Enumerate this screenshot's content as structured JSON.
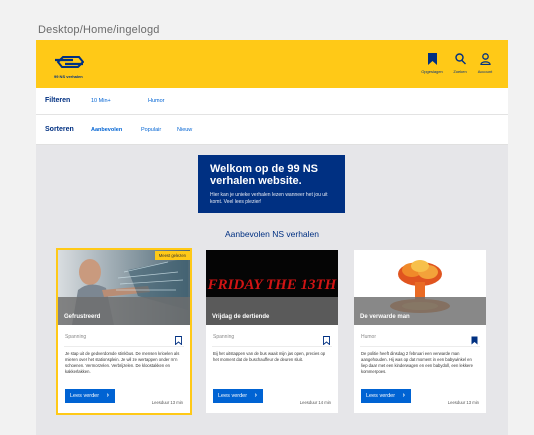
{
  "frame_label": "Desktop/Home/ingelogd",
  "header": {
    "logo_text": "99 NS verhalen",
    "nav": [
      {
        "label": "Opgeslagen",
        "icon": "bookmark-icon"
      },
      {
        "label": "Zoeken",
        "icon": "search-icon"
      },
      {
        "label": "Account",
        "icon": "user-icon"
      }
    ]
  },
  "filters": {
    "title": "Filteren",
    "options": [
      "10 Min+",
      "Humor"
    ]
  },
  "sort": {
    "title": "Sorteren",
    "options": [
      "Aanbevolen",
      "Populair",
      "Nieuw"
    ],
    "active": "Aanbevolen"
  },
  "hero": {
    "title": "Welkom op de 99 NS verhalen website.",
    "text": "Hier kan je unieke verhalen lezen wanneer het jou uit komt. Veel lees plezier!"
  },
  "section_title": "Aanbevolen NS verhalen",
  "cards": [
    {
      "title": "Gefrustreerd",
      "badge": "Meest gelezen",
      "genre": "Spanning",
      "saved": false,
      "description": "Je stap uit de gedverdomde stinkbus. De mensen krioelen als mieren over het stationsplein. Je wil ze wertappen onder m’n schoenen. Vermorzelen. Verbrijzelen. De kloostakken en kakkerlakken.",
      "button": "Lees verder",
      "read_time": "Leesduur 13 min"
    },
    {
      "title": "Vrijdag de dertiende",
      "genre": "Spanning",
      "saved": false,
      "image_text": "FRIDAY THE 13TH",
      "description": "Bij het uitstappen van de bus waait mijn jas open, precies op het moment dat de buschauffeur de deuren sluit.",
      "button": "Lees verder",
      "read_time": "Leesduur 14 min"
    },
    {
      "title": "De verwarde man",
      "genre": "Humor",
      "saved": true,
      "description": "De politie heeft dinsdag 2 februari een verwarde man aangehouden. Hij was op dat moment in een babywinkel en liep daar met een kinderwagen en een babydoll, een lekkere kommerpoes.",
      "button": "Lees verder",
      "read_time": "Leesduur 13 min"
    }
  ],
  "colors": {
    "brand_yellow": "#ffc917",
    "ns_blue": "#003082",
    "link_blue": "#0063d3"
  }
}
